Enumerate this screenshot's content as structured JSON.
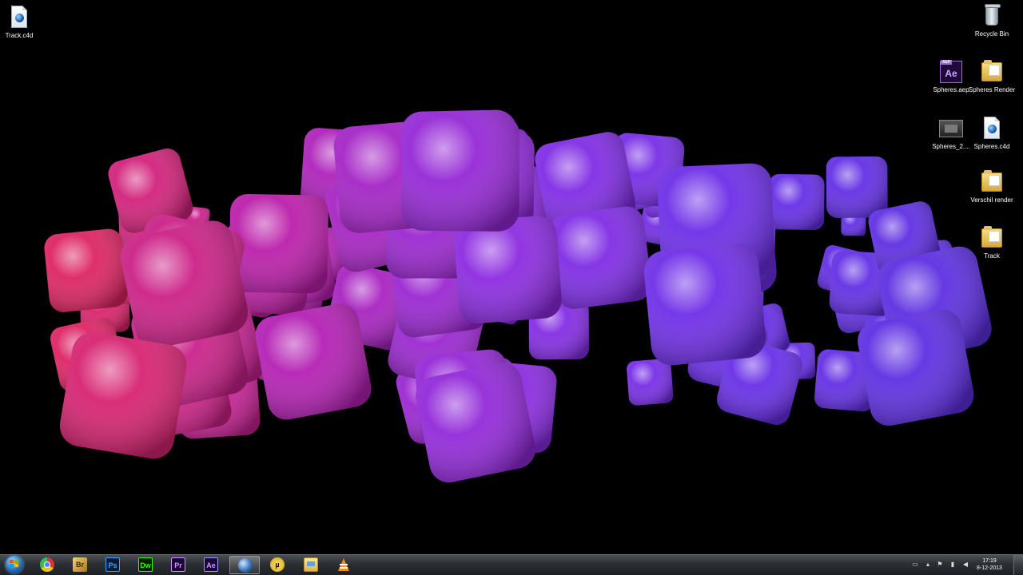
{
  "desktop": {
    "icons": [
      {
        "label": "Track.c4d",
        "icon": "cinema4d-file-icon"
      },
      {
        "label": "Recycle Bin",
        "icon": "recycle-bin-icon"
      },
      {
        "label": "Spheres.aep",
        "icon": "after-effects-project-icon",
        "badge": "AEP",
        "glyph": "Ae"
      },
      {
        "label": "Spheres Render",
        "icon": "folder-icon"
      },
      {
        "label": "Spheres_2....",
        "icon": "video-file-icon"
      },
      {
        "label": "Spheres.c4d",
        "icon": "cinema4d-file-icon"
      },
      {
        "label": "Verschil render",
        "icon": "folder-icon"
      },
      {
        "label": "Track",
        "icon": "folder-icon"
      }
    ],
    "wallpaper": {
      "description_colors": [
        "#e0245e",
        "#b81fb0",
        "#8a2be2",
        "#6a2ee8",
        "#5b2fe0"
      ]
    }
  },
  "taskbar": {
    "start": {
      "icon": "windows-orb-icon"
    },
    "pinned": [
      {
        "name": "chrome",
        "icon": "chrome-icon",
        "glyph": ""
      },
      {
        "name": "bridge",
        "icon": "bridge-icon",
        "glyph": "Br"
      },
      {
        "name": "photoshop",
        "icon": "photoshop-icon",
        "glyph": "Ps"
      },
      {
        "name": "dreamweaver",
        "icon": "dreamweaver-icon",
        "glyph": "Dw"
      },
      {
        "name": "premiere",
        "icon": "premiere-icon",
        "glyph": "Pr"
      },
      {
        "name": "after-effects",
        "icon": "after-effects-icon",
        "glyph": "Ae"
      },
      {
        "name": "cinema4d",
        "icon": "cinema4d-icon",
        "glyph": "",
        "active": true
      },
      {
        "name": "utorrent",
        "icon": "utorrent-icon",
        "glyph": "µ"
      },
      {
        "name": "explorer",
        "icon": "explorer-icon",
        "glyph": ""
      },
      {
        "name": "vlc",
        "icon": "vlc-icon",
        "glyph": ""
      }
    ],
    "tray": {
      "icons": [
        "keyboard-icon",
        "show-hidden-icon",
        "flag-icon",
        "network-icon",
        "volume-icon"
      ],
      "time": "17:19",
      "date": "8-12-2013"
    }
  }
}
